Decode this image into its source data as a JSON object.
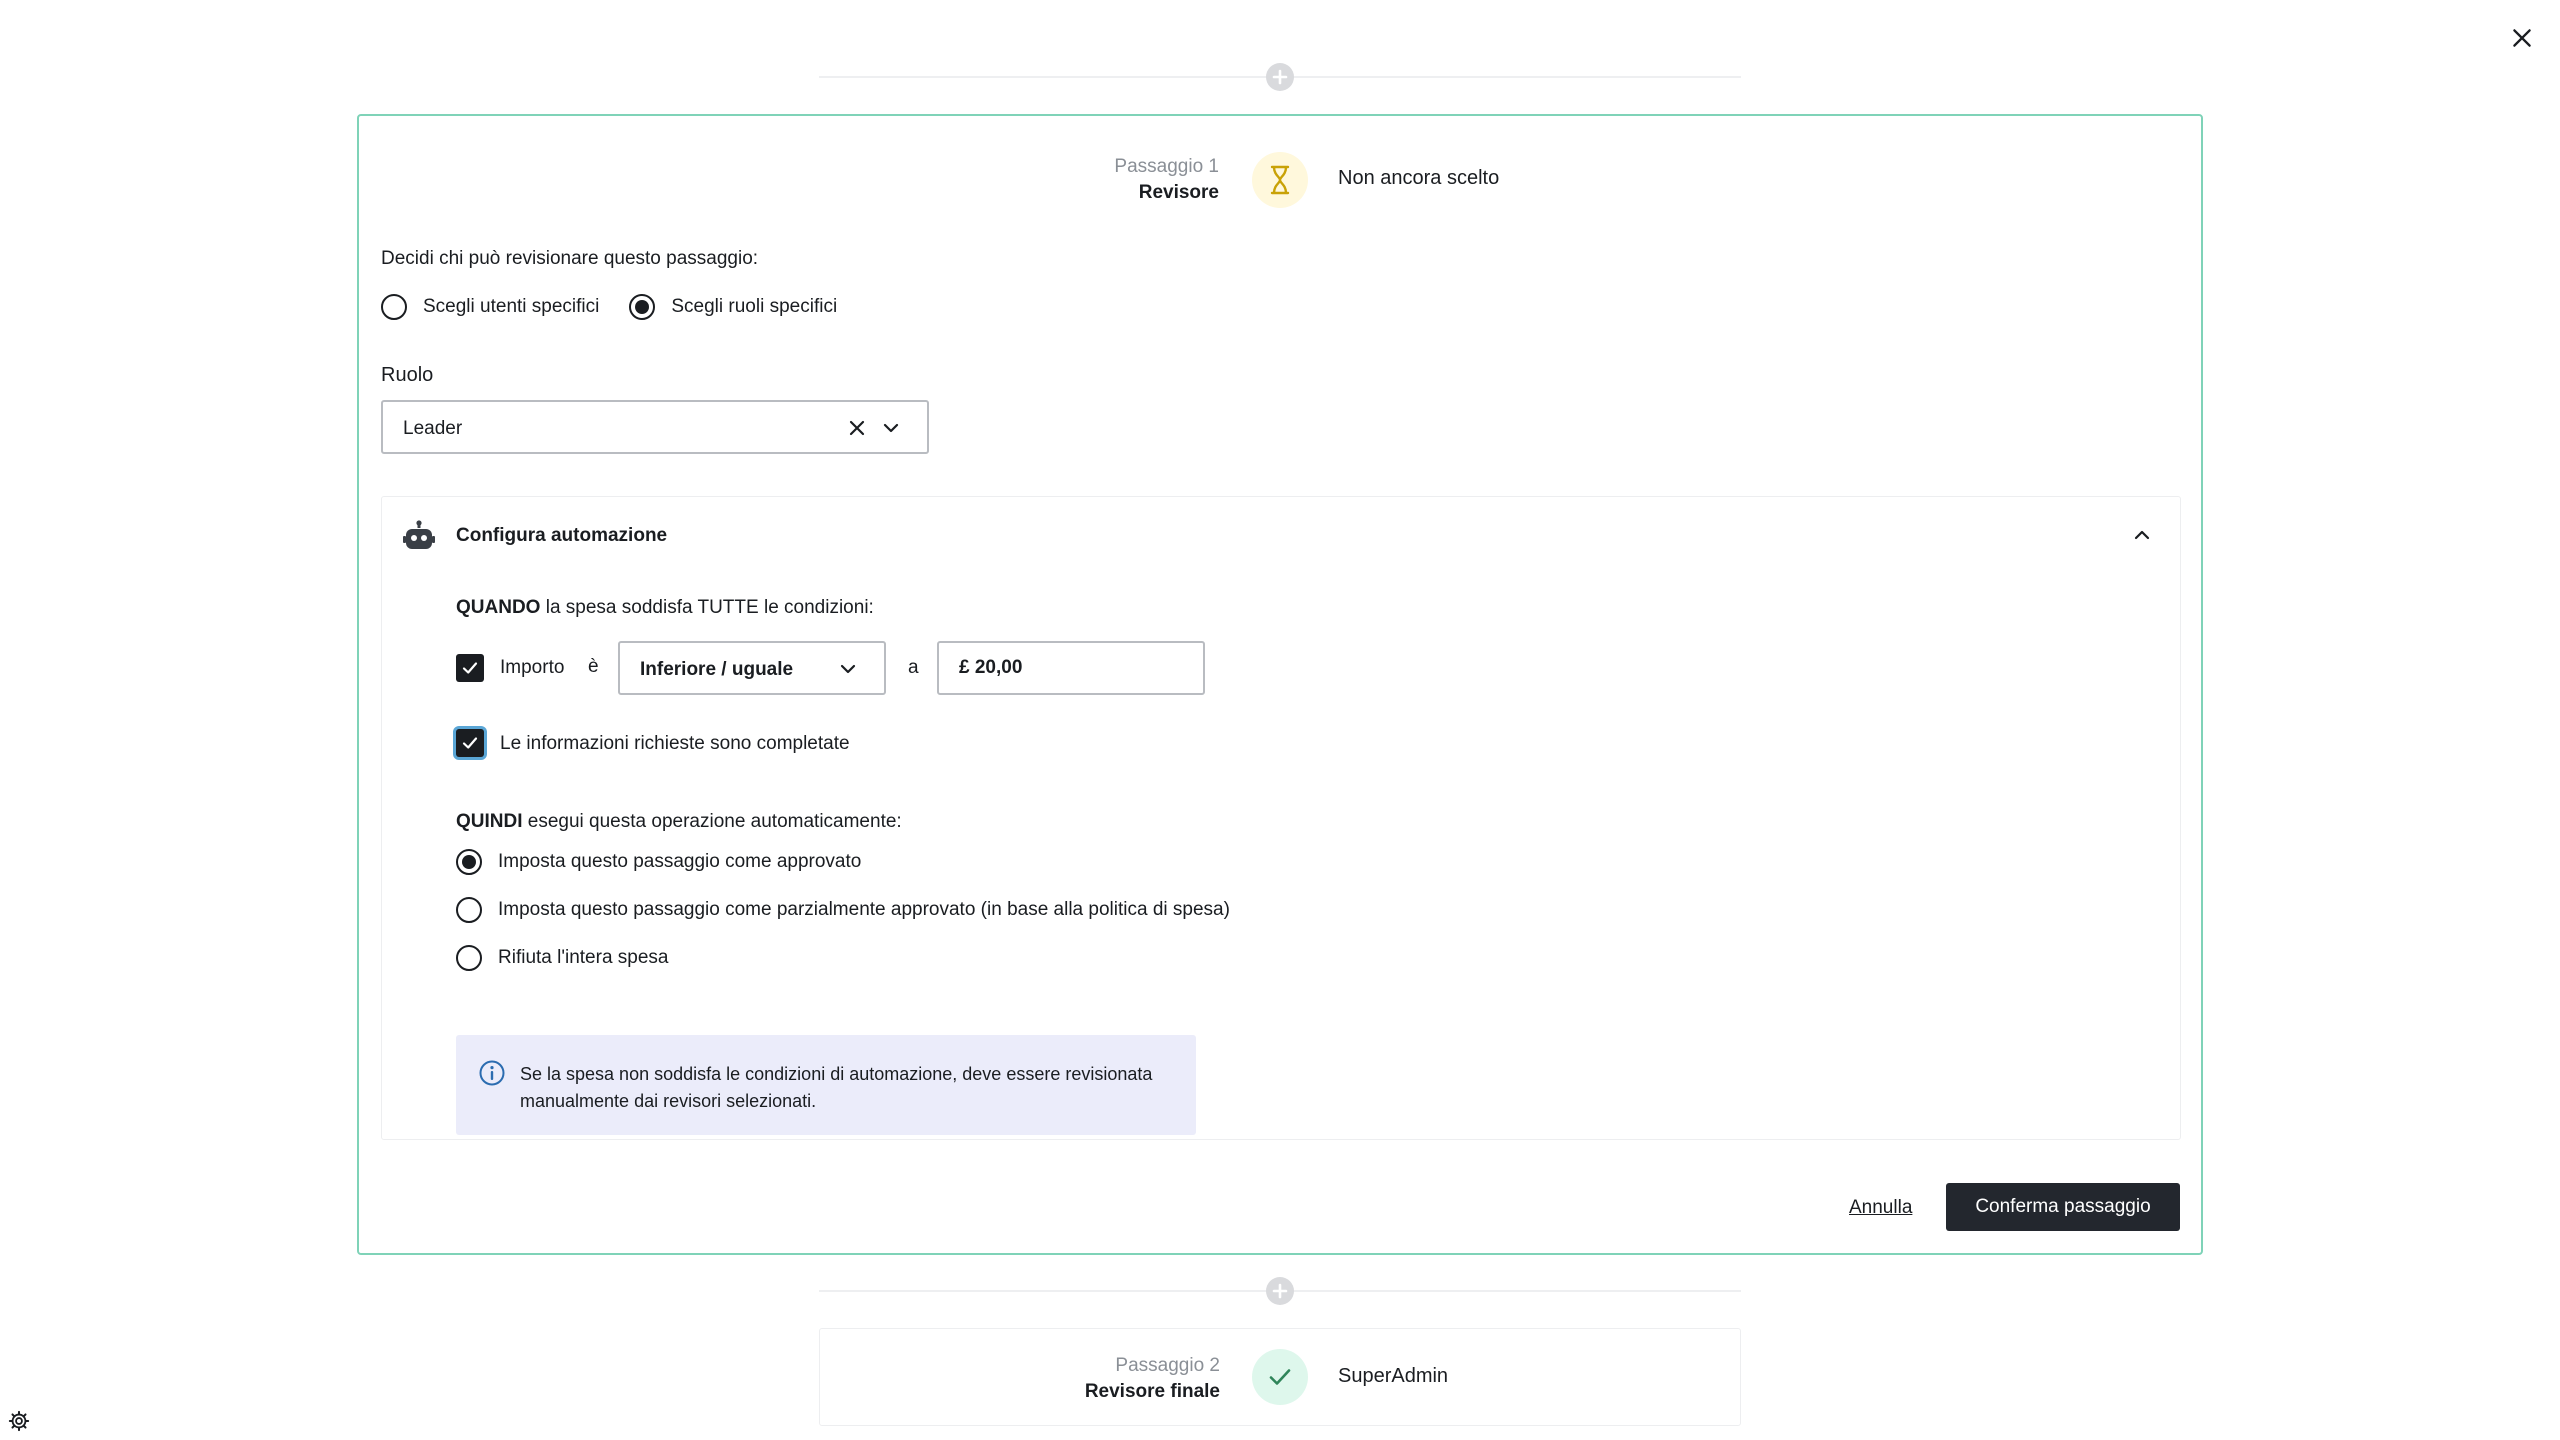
{
  "step1": {
    "number": "Passaggio 1",
    "role": "Revisore",
    "status": "Non ancora scelto",
    "status_icon": "hourglass-icon"
  },
  "reviewer_question": "Decidi chi può revisionare questo passaggio:",
  "reviewer_options": [
    {
      "label": "Scegli utenti specifici",
      "selected": false
    },
    {
      "label": "Scegli ruoli specifici",
      "selected": true
    }
  ],
  "role_field": {
    "label": "Ruolo",
    "value": "Leader"
  },
  "automation": {
    "title": "Configura automazione",
    "when_keyword": "QUANDO",
    "when_text": " la spesa soddisfa TUTTE le condizioni:",
    "condition_amount": {
      "checked": true,
      "label": "Importo",
      "is_label": "è",
      "operator": "Inferiore / uguale",
      "to_label": "a",
      "value": "£ 20,00"
    },
    "condition_info": {
      "checked": true,
      "label": "Le informazioni richieste sono completate"
    },
    "then_keyword": "QUINDI",
    "then_text": " esegui questa operazione automaticamente:",
    "actions": [
      {
        "label": "Imposta questo passaggio come approvato",
        "selected": true
      },
      {
        "label": "Imposta questo passaggio come parzialmente approvato (in base alla politica di spesa)",
        "selected": false
      },
      {
        "label": "Rifiuta l'intera spesa",
        "selected": false
      }
    ],
    "note": "Se la spesa non soddisfa le condizioni di automazione, deve essere revisionata manualmente dai revisori selezionati."
  },
  "buttons": {
    "cancel": "Annulla",
    "confirm": "Conferma passaggio"
  },
  "step2": {
    "number": "Passaggio 2",
    "role": "Revisore finale",
    "status": "SuperAdmin",
    "status_icon": "check-icon"
  },
  "colors": {
    "accent_border": "#7fd3b8",
    "primary_button": "#23272e",
    "info_box": "#ebecfa",
    "hourglass_bg": "#fff8dc",
    "check_bg": "#def7ec"
  }
}
